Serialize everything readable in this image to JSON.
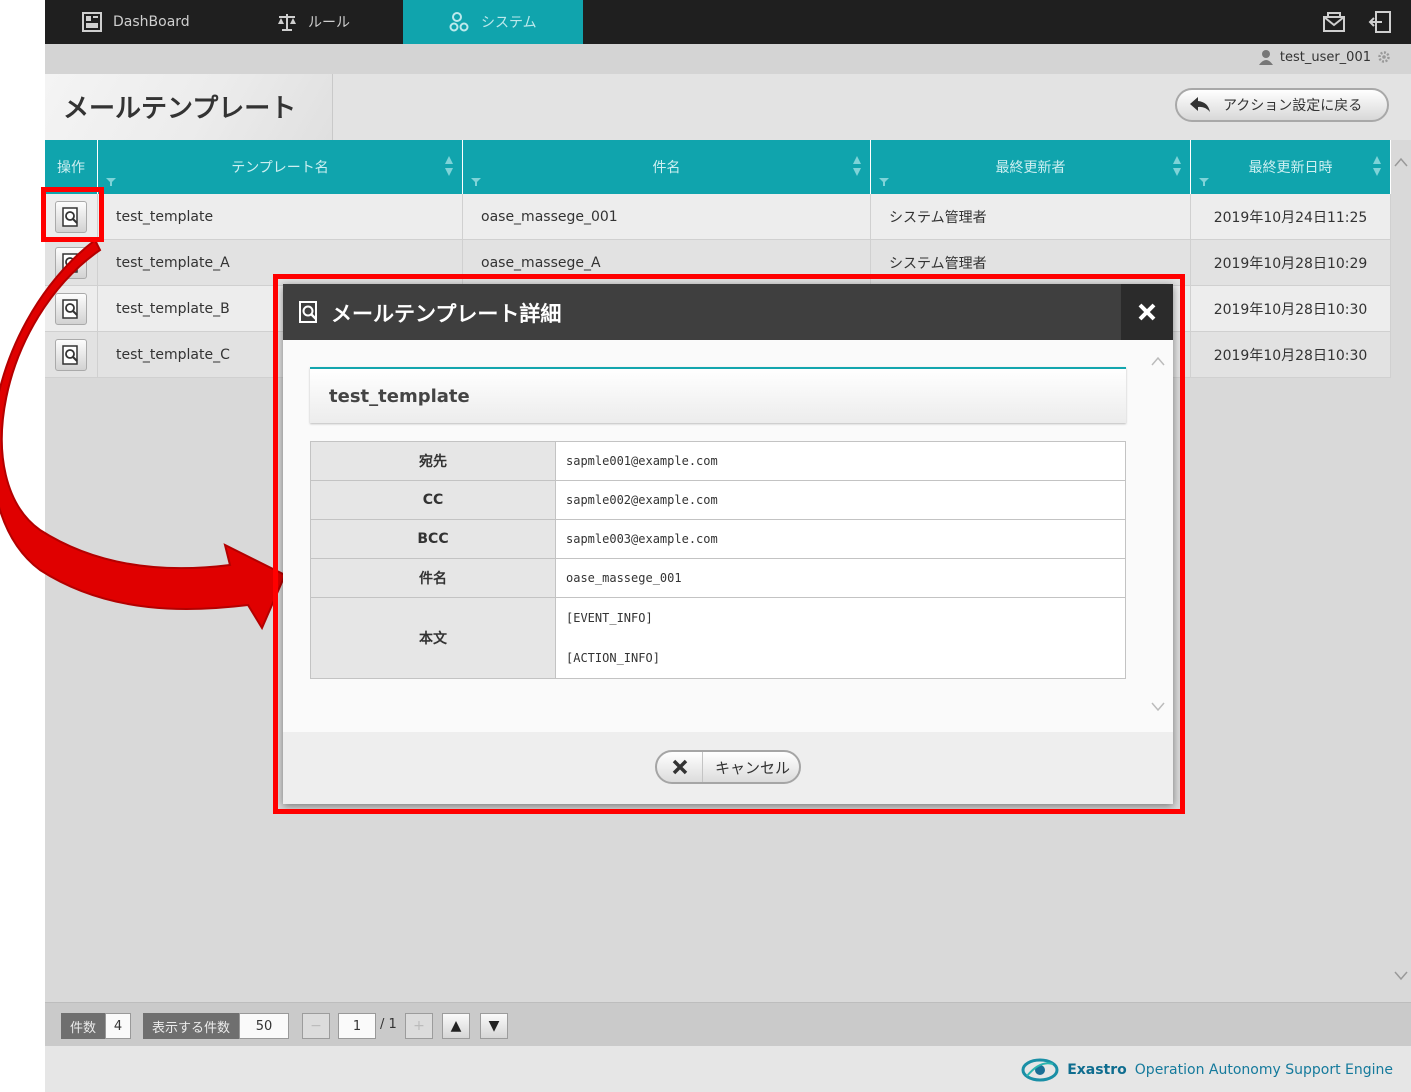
{
  "nav": {
    "items": [
      {
        "label": "DashBoard",
        "icon": "dashboard-icon"
      },
      {
        "label": "ルール",
        "icon": "scale-icon"
      },
      {
        "label": "システム",
        "icon": "system-gears-icon",
        "active": true
      }
    ],
    "right_icons": [
      "mail-icon",
      "logout-icon"
    ]
  },
  "user": {
    "name": "test_user_001",
    "icons": [
      "user-icon",
      "settings-gear-icon"
    ]
  },
  "page": {
    "title": "メールテンプレート",
    "back_button": "アクション設定に戻る"
  },
  "table": {
    "columns": [
      "操作",
      "テンプレート名",
      "件名",
      "最終更新者",
      "最終更新日時"
    ],
    "rows": [
      {
        "name": "test_template",
        "subject": "oase_massege_001",
        "updater": "システム管理者",
        "updated": "2019年10月24日11:25"
      },
      {
        "name": "test_template_A",
        "subject": "oase_massege_A",
        "updater": "システム管理者",
        "updated": "2019年10月28日10:29"
      },
      {
        "name": "test_template_B",
        "subject": "",
        "updater": "",
        "updated": "2019年10月28日10:30"
      },
      {
        "name": "test_template_C",
        "subject": "",
        "updater": "",
        "updated": "2019年10月28日10:30"
      }
    ]
  },
  "pager": {
    "count_label": "件数",
    "count": "4",
    "per_page_label": "表示する件数",
    "per_page": "50",
    "minus": "−",
    "page": "1",
    "total": "/ 1",
    "plus": "+",
    "up": "▲",
    "down": "▼"
  },
  "footer": {
    "brand": "Exastro",
    "product": "Operation Autonomy Support Engine"
  },
  "modal": {
    "title": "メールテンプレート詳細",
    "template_name": "test_template",
    "fields": {
      "to_label": "宛先",
      "to": "sapmle001@example.com",
      "cc_label": "CC",
      "cc": "sapmle002@example.com",
      "bcc_label": "BCC",
      "bcc": "sapmle003@example.com",
      "subject_label": "件名",
      "subject": "oase_massege_001",
      "body_label": "本文",
      "body": "[EVENT_INFO]\n[ACTION_INFO]"
    },
    "cancel_label": "キャンセル"
  },
  "colors": {
    "accent": "#10a4ad",
    "highlight": "#ff0000",
    "header_dark": "#1f1f1f"
  }
}
